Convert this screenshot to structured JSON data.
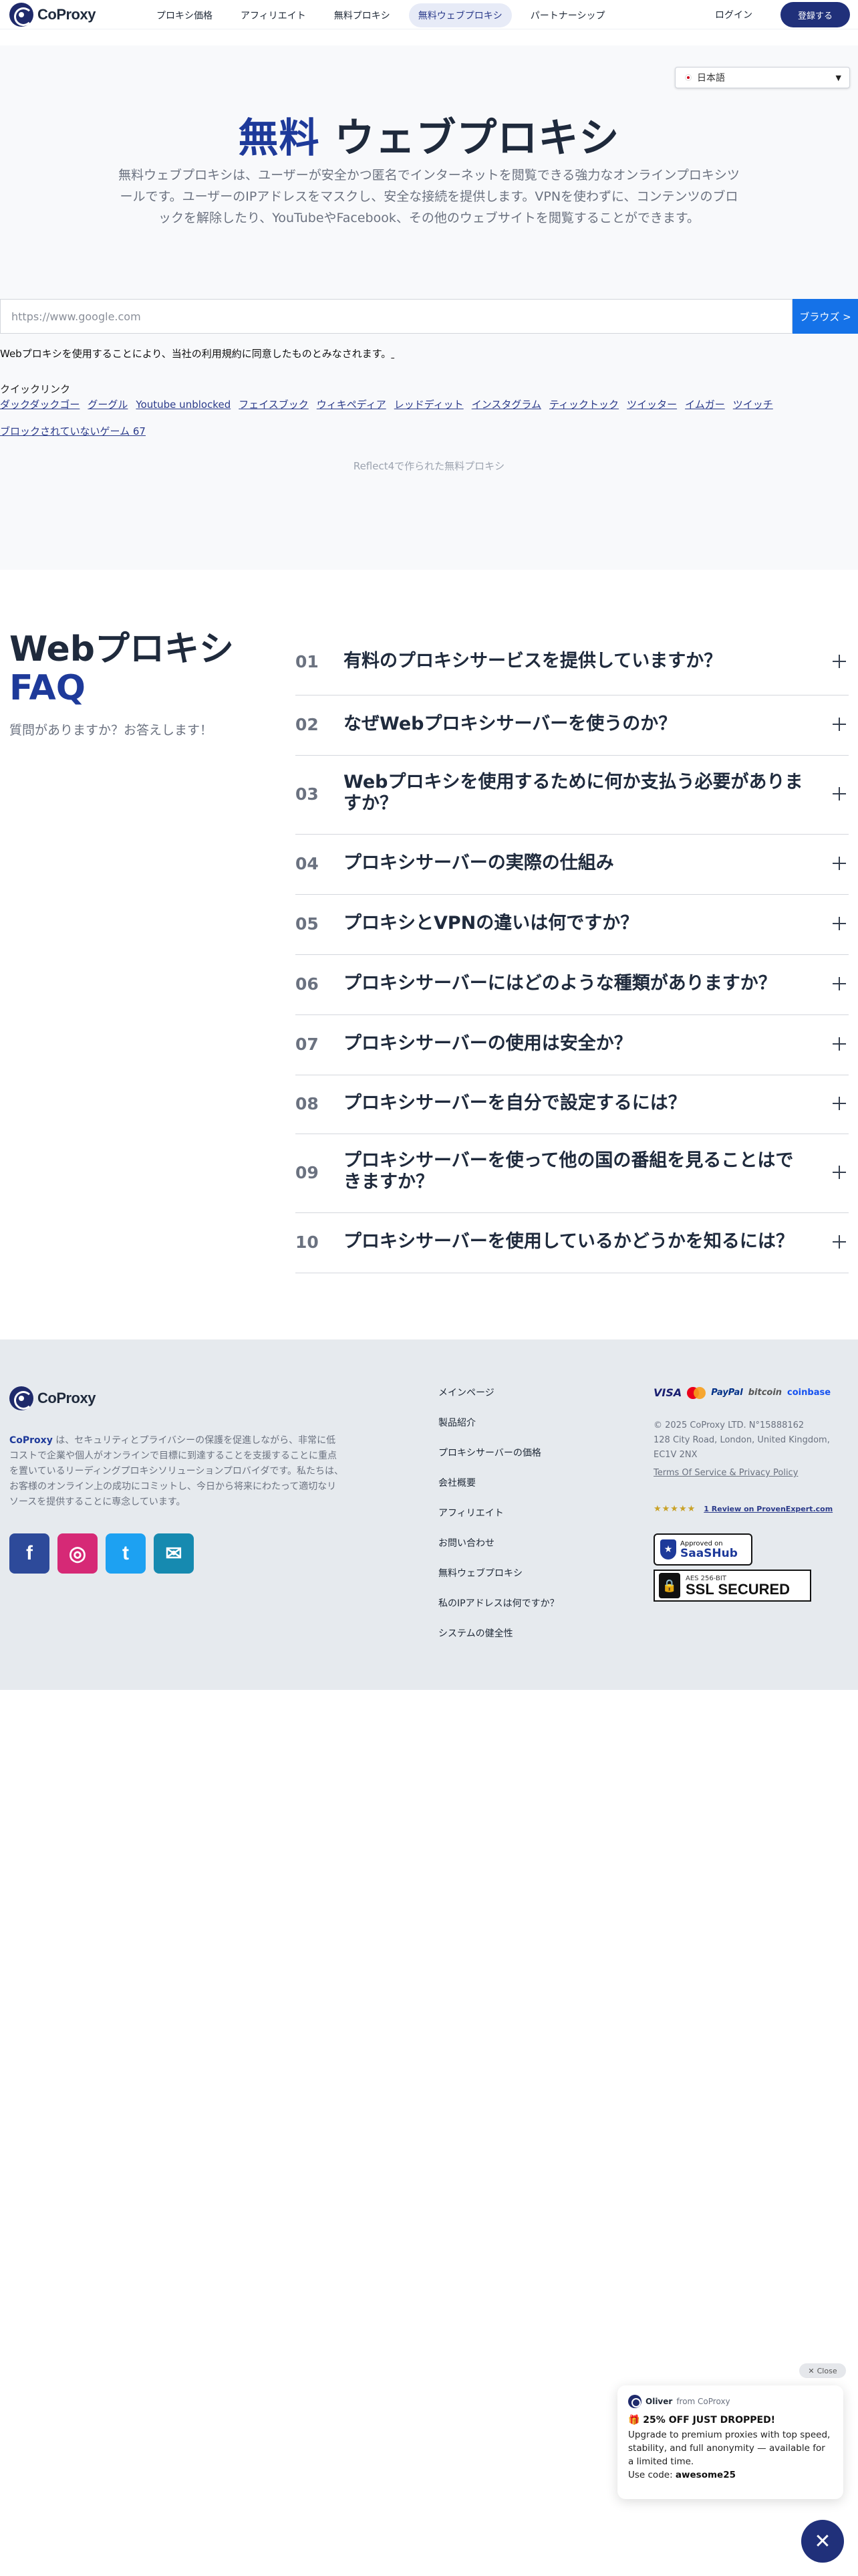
{
  "nav": {
    "logo_text": "CoProxy",
    "links": [
      {
        "label": "プロキシ価格",
        "active": false
      },
      {
        "label": "アフィリエイト",
        "active": false
      },
      {
        "label": "無料プロキシ",
        "active": false
      },
      {
        "label": "無料ウェブプロキシ",
        "active": true
      },
      {
        "label": "パートナーシップ",
        "active": false
      }
    ],
    "login": "ログイン",
    "signup": "登録する"
  },
  "language": {
    "selected": "日本語",
    "icon": "chevron-down-icon"
  },
  "hero": {
    "title_accent": "無料",
    "title_rest": " ウェブプロキシ",
    "description": "無料ウェブプロキシは、ユーザーが安全かつ匿名でインターネットを閲覧できる強力なオンラインプロキシツールです。ユーザーのIPアドレスをマスクし、安全な接続を提供します。VPNを使わずに、コンテンツのブロックを解除したり、YouTubeやFacebook、その他のウェブサイトを閲覧することができます。",
    "url_placeholder": "https://www.google.com",
    "browse_button": "ブラウズ >",
    "terms": "Webプロキシを使用することにより、当社の利用規約に同意したものとみなされます。",
    "quick_label": "クイックリンク",
    "quick_links": [
      "ダックダックゴー",
      "グーグル",
      "Youtube unblocked",
      "フェイスブック",
      "ウィキペディア",
      "レッドディット",
      "インスタグラム",
      "ティックトック",
      "ツイッター",
      "イムガー",
      "ツイッチ",
      "ブロックされていないゲーム 67"
    ],
    "made_by": "Reflect4で作られた無料プロキシ"
  },
  "faq": {
    "title_line1": "Webプロキシ",
    "title_line2": "FAQ",
    "subtitle": "質問がありますか？お答えします！",
    "items": [
      {
        "num": "01",
        "q": "有料のプロキシサービスを提供していますか？"
      },
      {
        "num": "02",
        "q": "なぜWebプロキシサーバーを使うのか？"
      },
      {
        "num": "03",
        "q": "Webプロキシを使用するために何か支払う必要がありますか？"
      },
      {
        "num": "04",
        "q": "プロキシサーバーの実際の仕組み"
      },
      {
        "num": "05",
        "q": "プロキシとVPNの違いは何ですか？"
      },
      {
        "num": "06",
        "q": "プロキシサーバーにはどのような種類がありますか？"
      },
      {
        "num": "07",
        "q": "プロキシサーバーの使用は安全か？"
      },
      {
        "num": "08",
        "q": "プロキシサーバーを自分で設定するには？"
      },
      {
        "num": "09",
        "q": "プロキシサーバーを使って他の国の番組を見ることはできますか？"
      },
      {
        "num": "10",
        "q": "プロキシサーバーを使用しているかどうかを知るには？"
      }
    ]
  },
  "footer": {
    "logo_text": "CoProxy",
    "brand": "CoProxy",
    "description": " は、セキュリティとプライバシーの保護を促進しながら、非常に低コストで企業や個人がオンラインで目標に到達することを支援することに重点を置いているリーディングプロキシソリューションプロバイダです。私たちは、お客様のオンライン上の成功にコミットし、今日から将来にわたって適切なリソースを提供することに専念しています。",
    "socials": [
      "f",
      "◎",
      "t",
      "✉"
    ],
    "links": [
      "メインページ",
      "製品紹介",
      "プロキシサーバーの価格",
      "会社概要",
      "アフィリエイト",
      "お問い合わせ",
      "無料ウェブプロキシ",
      "私のIPアドレスは何ですか？",
      "システムの健全性"
    ],
    "payments": {
      "visa": "VISA",
      "paypal": "PayPal",
      "bitcoin": "bitcoin",
      "coinbase": "coinbase"
    },
    "copyright": "© 2025 CoProxy LTD. N°15888162",
    "address": "128 City Road, London, United Kingdom, EC1V 2NX",
    "terms": "Terms Of Service & Privacy Policy",
    "review_stars": "★★★★★",
    "review_link": "1 Review on ProvenExpert.com",
    "saas_line1": "Approved on",
    "saas_line2": "SaaSHub",
    "ssl_line1": "AES 256-BIT",
    "ssl_line2": "SSL SECURED"
  },
  "popup": {
    "close": "Close",
    "sender": "Oliver",
    "from": "from CoProxy",
    "title": "🎁 25% OFF JUST DROPPED!",
    "body": "Upgrade to premium proxies with top speed, stability, and full anonymity — available for a limited time.",
    "code_label": "Use code: ",
    "code": "awesome25"
  },
  "colors": {
    "brand": "#20307a",
    "accent": "#1e3a9a",
    "button": "#1572e8"
  }
}
